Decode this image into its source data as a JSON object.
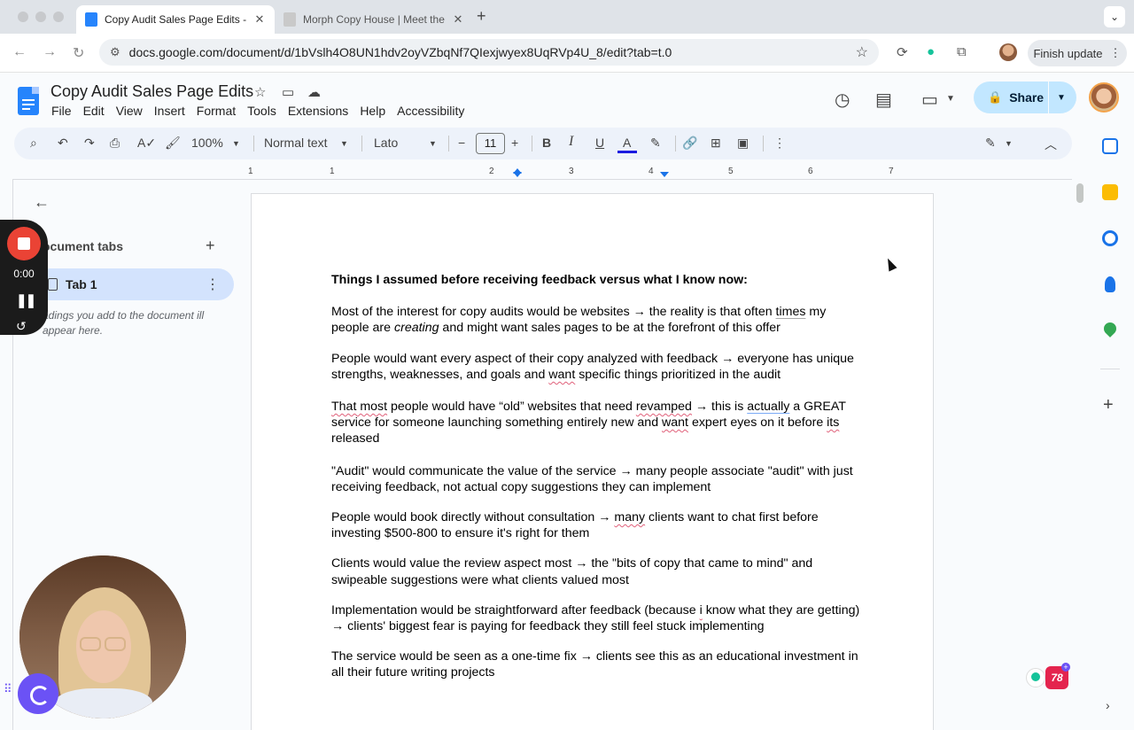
{
  "browser": {
    "tabs": [
      {
        "title": "Copy Audit Sales Page Edits -",
        "active": true
      },
      {
        "title": "Morph Copy House | Meet the",
        "active": false
      }
    ],
    "url": "docs.google.com/document/d/1bVslh4O8UN1hdv2oyVZbqNf7QIexjwyex8UqRVp4U_8/edit?tab=t.0",
    "finish_update": "Finish update"
  },
  "docs": {
    "title": "Copy Audit Sales Page Edits",
    "menu": [
      "File",
      "Edit",
      "View",
      "Insert",
      "Format",
      "Tools",
      "Extensions",
      "Help",
      "Accessibility"
    ],
    "share_label": "Share",
    "toolbar": {
      "zoom": "100%",
      "style": "Normal text",
      "font": "Lato",
      "font_size": "11",
      "minus": "−",
      "plus": "+"
    },
    "ruler_marks": [
      "1",
      "2",
      "3",
      "4",
      "5",
      "6",
      "7"
    ],
    "ruler_left_mark": "1"
  },
  "outline": {
    "heading": "ocument tabs",
    "tab_label": "Tab 1",
    "hint": "adings you add to the document ill appear here."
  },
  "recorder": {
    "time": "0:00"
  },
  "grammarly": {
    "count": "78"
  },
  "colors": {
    "accent": "#1a73e8",
    "share_bg": "#c2e7ff",
    "record_red": "#ea4335",
    "spell_error": "#e0607a"
  },
  "document": {
    "heading": "Things I assumed before receiving feedback versus what I know now:",
    "p1a": "Most of the interest for copy audits would be websites → the reality is that often ",
    "p1b": "times",
    "p1c": " my people are ",
    "p1d": "creating",
    "p1e": " and might want sales pages to be at the forefront of this offer",
    "p2a": "People would want every aspect of their copy analyzed with feedback → everyone has unique strengths, weaknesses, and goals and ",
    "p2b": "want",
    "p2c": " specific things prioritized in the audit",
    "p3a": "That most",
    "p3b": " people would have “old” websites that need ",
    "p3c": "revamped",
    "p3d": " → this is ",
    "p3e": "actually",
    "p3f": " a GREAT service for someone launching something entirely new and ",
    "p3g": "want",
    "p3h": " expert eyes on it before ",
    "p3i": "its",
    "p3j": " released",
    "p4": "\"Audit\" would communicate the value of the service → many people associate \"audit\" with just receiving feedback, not actual copy suggestions they can implement",
    "p5a": "People would book directly without consultation → ",
    "p5b": "many",
    "p5c": " clients want to chat first before investing $500-800 to ensure it's right for them",
    "p6": "Clients would value the review aspect most → the \"bits of copy that came to mind\" and swipeable suggestions were what clients valued most",
    "p7a": "Implementation would be straightforward after feedback (because ",
    "p7b": "i",
    "p7c": " know what they are getting) → clients' biggest fear is paying for feedback they still feel stuck implementing",
    "p8": "The service would be seen as a one-time fix → clients see this as an educational investment in all their future writing projects"
  }
}
